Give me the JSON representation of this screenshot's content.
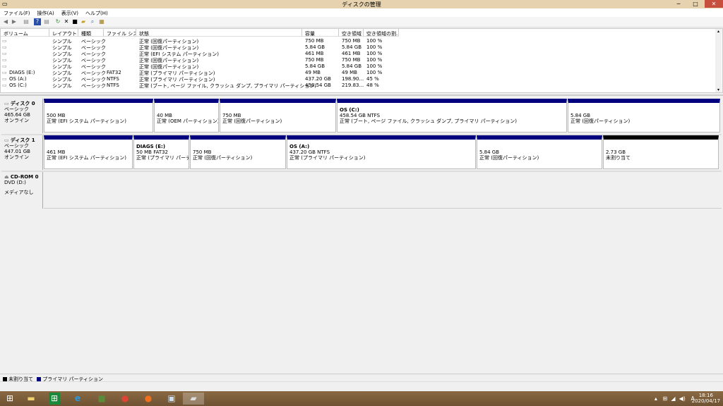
{
  "window": {
    "title": "ディスクの管理",
    "minimize": "─",
    "maximize": "□",
    "close": "✕"
  },
  "menu": [
    "ファイル(F)",
    "操作(A)",
    "表示(V)",
    "ヘルプ(H)"
  ],
  "toolbar_icons": [
    "back-arrow-icon",
    "forward-arrow-icon",
    "console-icon",
    "help-icon",
    "view-icon",
    "refresh-icon",
    "delete-icon",
    "properties-icon",
    "open-icon",
    "search-icon",
    "settings-icon"
  ],
  "list": {
    "columns": [
      "ボリューム",
      "レイアウト",
      "種類",
      "ファイル シス...",
      "状態",
      "容量",
      "空き領域",
      "空き領域の割..."
    ],
    "rows": [
      [
        "",
        "シンプル",
        "ベーシック",
        "",
        "正常 (回復パーティション)",
        "750 MB",
        "750 MB",
        "100 %"
      ],
      [
        "",
        "シンプル",
        "ベーシック",
        "",
        "正常 (回復パーティション)",
        "5.84 GB",
        "5.84 GB",
        "100 %"
      ],
      [
        "",
        "シンプル",
        "ベーシック",
        "",
        "正常 (EFI システム パーティション)",
        "461 MB",
        "461 MB",
        "100 %"
      ],
      [
        "",
        "シンプル",
        "ベーシック",
        "",
        "正常 (回復パーティション)",
        "750 MB",
        "750 MB",
        "100 %"
      ],
      [
        "",
        "シンプル",
        "ベーシック",
        "",
        "正常 (回復パーティション)",
        "5.84 GB",
        "5.84 GB",
        "100 %"
      ],
      [
        "DIAGS (E:)",
        "シンプル",
        "ベーシック",
        "FAT32",
        "正常 (プライマリ パーティション)",
        "49 MB",
        "49 MB",
        "100 %"
      ],
      [
        "OS (A:)",
        "シンプル",
        "ベーシック",
        "NTFS",
        "正常 (プライマリ パーティション)",
        "437.20 GB",
        "198.90...",
        "45 %"
      ],
      [
        "OS (C:)",
        "シンプル",
        "ベーシック",
        "NTFS",
        "正常 (ブート, ページ ファイル, クラッシュ ダンプ, プライマリ パーティション)",
        "458.54 GB",
        "219.83...",
        "48 %"
      ]
    ]
  },
  "disks": [
    {
      "name": "ディスク 0",
      "type": "ベーシック",
      "size": "465.64 GB",
      "status": "オンライン",
      "partitions": [
        {
          "title": "",
          "size": "500 MB",
          "desc": "正常 (EFI システム パーティション)"
        },
        {
          "title": "",
          "size": "40 MB",
          "desc": "正常 (OEM パーティション)"
        },
        {
          "title": "",
          "size": "750 MB",
          "desc": "正常 (回復パーティション)"
        },
        {
          "title": "OS  (C:)",
          "size": "458.54 GB NTFS",
          "desc": "正常 (ブート, ページ ファイル, クラッシュ ダンプ, プライマリ パーティション)"
        },
        {
          "title": "",
          "size": "5.84 GB",
          "desc": "正常 (回復パーティション)"
        }
      ]
    },
    {
      "name": "ディスク 1",
      "type": "ベーシック",
      "size": "447.01 GB",
      "status": "オンライン",
      "partitions": [
        {
          "title": "",
          "size": "461 MB",
          "desc": "正常 (EFI システム パーティション)"
        },
        {
          "title": "DIAGS  (E:)",
          "size": "50 MB FAT32",
          "desc": "正常 (プライマリ パーティション)"
        },
        {
          "title": "",
          "size": "750 MB",
          "desc": "正常 (回復パーティション)"
        },
        {
          "title": "OS  (A:)",
          "size": "437.20 GB NTFS",
          "desc": "正常 (プライマリ パーティション)"
        },
        {
          "title": "",
          "size": "5.84 GB",
          "desc": "正常 (回復パーティション)"
        },
        {
          "title": "",
          "size": "2.73 GB",
          "desc": "未割り当て"
        }
      ]
    }
  ],
  "cdrom": {
    "name": "CD-ROM 0",
    "drive": "DVD (D:)",
    "status": "メディアなし"
  },
  "legend": [
    {
      "label": "未割り当て",
      "color": "#000000"
    },
    {
      "label": "プライマリ パーティション",
      "color": "#00007f"
    }
  ],
  "taskbar": {
    "apps": [
      "start-icon",
      "file-explorer-icon",
      "store-icon",
      "internet-explorer-icon",
      "minecraft-icon",
      "chrome-icon",
      "firefox-icon",
      "app-icon",
      "disk-management-icon"
    ],
    "tray": {
      "ime": "A",
      "time": "18:16",
      "date": "2020/04/17"
    }
  },
  "colors": {
    "primary_partition": "#00007f",
    "unallocated": "#000000",
    "titlebar": "#e6d2ae"
  }
}
